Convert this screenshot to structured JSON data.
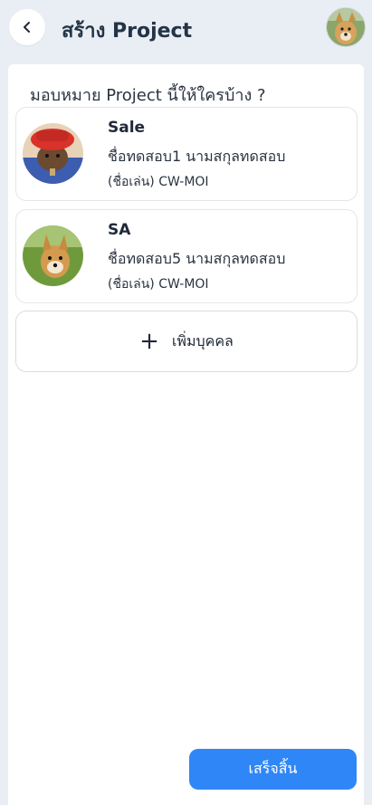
{
  "header": {
    "title": "สร้าง Project",
    "back_icon": "chevron-left-icon",
    "user_avatar": "dog-avatar"
  },
  "main": {
    "question": "มอบหมาย Project นี้ให้ใครบ้าง ?",
    "assignees": [
      {
        "role": "Sale",
        "name": "ชื่อทดสอบ1 นามสกุลทดสอบ",
        "nickname": "(ชื่อเล่น) CW-MOI",
        "avatar": "dog-red-hat-avatar"
      },
      {
        "role": "SA",
        "name": "ชื่อทดสอบ5 นามสกุลทดสอบ",
        "nickname": "(ชื่อเล่น) CW-MOI",
        "avatar": "dog-grass-avatar"
      }
    ],
    "add_person": {
      "icon": "plus-icon",
      "label": "เพิ่มบุคคล",
      "glyph": "+"
    }
  },
  "footer": {
    "finish_label": "เสร็จสิ้น"
  },
  "colors": {
    "background": "#e9eef4",
    "primary": "#2f86f6",
    "text": "#1f2937"
  }
}
